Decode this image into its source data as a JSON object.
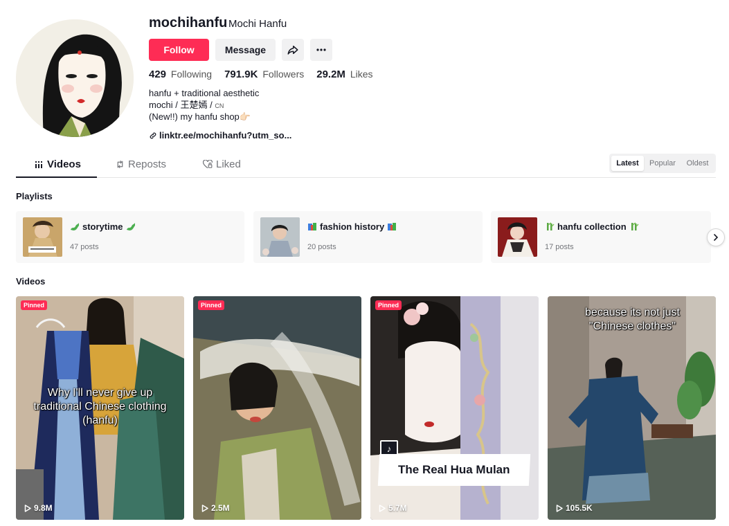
{
  "profile": {
    "username": "mochihanfu",
    "nickname": "Mochi  Hanfu",
    "follow_label": "Follow",
    "message_label": "Message",
    "stats": {
      "following_count": "429",
      "following_label": "Following",
      "followers_count": "791.9K",
      "followers_label": "Followers",
      "likes_count": "29.2M",
      "likes_label": "Likes"
    },
    "bio": {
      "line1": "hanfu + traditional aesthetic",
      "line2": "mochi / 王楚嫣 / ",
      "line2_flag": "CN",
      "line3": "(New!!) my hanfu shop👉🏻"
    },
    "link": "linktr.ee/mochihanfu?utm_so..."
  },
  "tabs": [
    {
      "label": "Videos",
      "active": true,
      "icon": "grid-icon"
    },
    {
      "label": "Reposts",
      "active": false,
      "icon": "repost-icon"
    },
    {
      "label": "Liked",
      "active": false,
      "icon": "heart-lock-icon"
    }
  ],
  "sort": {
    "options": [
      "Latest",
      "Popular",
      "Oldest"
    ],
    "selected": "Latest"
  },
  "playlists": {
    "title": "Playlists",
    "items": [
      {
        "name": "storytime",
        "count": "47 posts",
        "emoji": "dragon"
      },
      {
        "name": "fashion history",
        "count": "20 posts",
        "emoji": "books"
      },
      {
        "name": "hanfu collection",
        "count": "17 posts",
        "emoji": "bamboo"
      }
    ]
  },
  "videos": {
    "title": "Videos",
    "items": [
      {
        "views": "9.8M",
        "pinned": "Pinned",
        "caption": "Why I'll never give up traditional Chinese clothing (hanfu)"
      },
      {
        "views": "2.5M",
        "pinned": "Pinned",
        "caption": ""
      },
      {
        "views": "5.7M",
        "pinned": "Pinned",
        "caption": "The Real Hua Mulan"
      },
      {
        "views": "105.5K",
        "pinned": "",
        "caption": "because its not just \"Chinese clothes\""
      }
    ]
  },
  "colors": {
    "accent": "#fe2c55",
    "text": "#161823",
    "muted": "#73757a",
    "button_bg": "#f1f1f2"
  }
}
